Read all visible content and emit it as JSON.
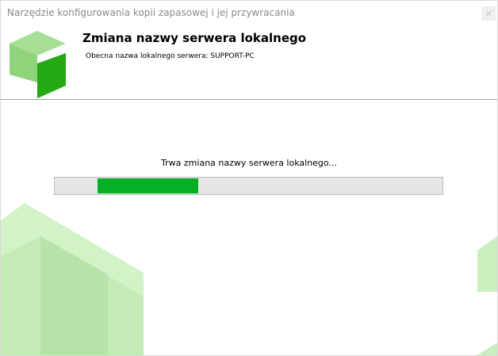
{
  "window": {
    "title": "Narzędzie konfigurowania kopii zapasowej i jej przywracania",
    "close_icon": "×"
  },
  "header": {
    "title": "Zmiana nazwy serwera lokalnego",
    "subtitle": "Obecna nazwa lokalnego serwera: SUPPORT-PC"
  },
  "main": {
    "status": "Trwa zmiana nazwy serwera lokalnego...",
    "progress": {
      "mode": "marquee",
      "segment_start": 0.11,
      "segment_end": 0.37
    }
  },
  "colors": {
    "progress_fill": "#06b025",
    "progress_track": "#e6e6e6",
    "logo_light": "#8fd47a",
    "logo_dark": "#24a814",
    "deco_light": "#d2f2c8",
    "deco_mid": "#bfe6b0"
  }
}
